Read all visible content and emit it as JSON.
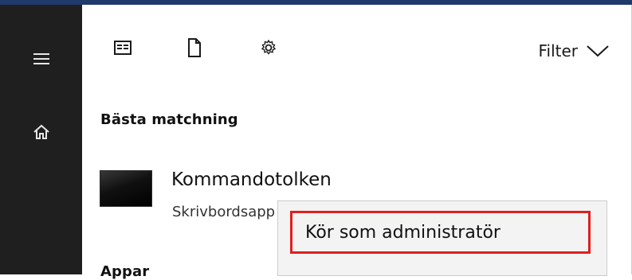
{
  "toolbar": {
    "filter_label": "Filter"
  },
  "results": {
    "best_match_title": "Bästa matchning",
    "best_match_name": "Kommandotolken",
    "best_match_subtitle": "Skrivbordsapp",
    "next_section_title": "Appar"
  },
  "context_menu": {
    "run_as_admin_label": "Kör som administratör"
  }
}
